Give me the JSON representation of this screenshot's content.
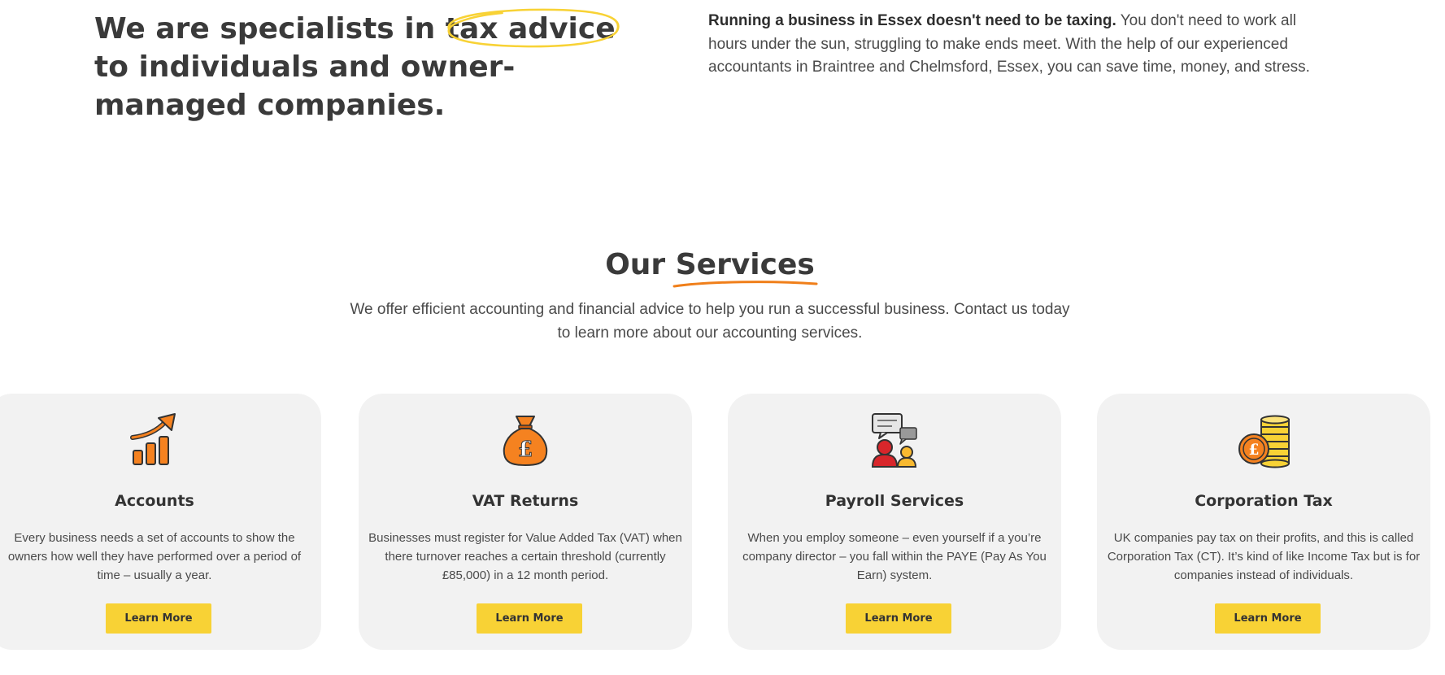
{
  "hero": {
    "title_before": "We are specialists in ",
    "title_highlight": "tax advice",
    "title_after": " to individuals and owner-managed companies.",
    "intro_bold": "Running a business in Essex doesn't need to be taxing.",
    "intro_rest": " You don't need to work all hours under the sun, struggling to make ends meet. With the help of our experienced accountants in Braintree and Chelmsford, Essex, you can save time, money, and stress."
  },
  "services": {
    "heading_plain": "Our ",
    "heading_underlined": "Services",
    "intro": "We offer efficient accounting and financial advice to help you run a successful business. Contact us today to learn more about our accounting services.",
    "cards": [
      {
        "title": "Accounts",
        "icon": "growth-chart-icon",
        "description": "Every business needs a set of accounts to show the owners how well they have performed over a period of time – usually a year.",
        "button": "Learn More"
      },
      {
        "title": "VAT Returns",
        "icon": "money-bag-icon",
        "description": "Businesses must register for Value Added Tax (VAT) when there turnover reaches a certain threshold (currently £85,000) in a 12 month period.",
        "button": "Learn More"
      },
      {
        "title": "Payroll Services",
        "icon": "people-chat-icon",
        "description": "When you employ someone – even yourself if a you’re company director – you fall within the PAYE (Pay As You Earn) system.",
        "button": "Learn More"
      },
      {
        "title": "Corporation Tax",
        "icon": "coin-stack-icon",
        "description": "UK companies pay tax on their profits, and this is called Corporation Tax (CT). It’s kind of like Income Tax but  is for companies instead of individuals.",
        "button": "Learn More"
      }
    ]
  },
  "colors": {
    "accent_yellow": "#f8d235",
    "accent_orange": "#f07f1a",
    "card_bg": "#f2f2f2",
    "text_dark": "#3a3a3a"
  },
  "icon_glyphs": {
    "pound": "£"
  }
}
